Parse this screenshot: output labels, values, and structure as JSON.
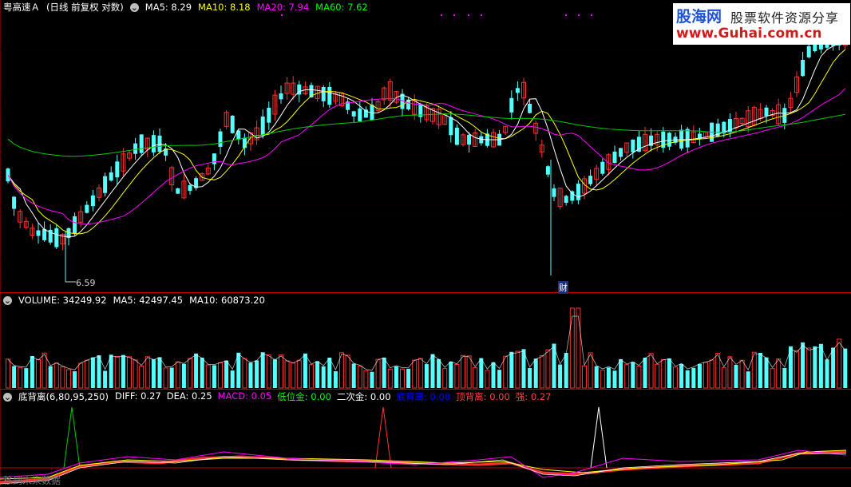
{
  "price_panel": {
    "stock_name": "粤高速Ａ",
    "mode": "(日线 前复权 对数)",
    "ma": [
      {
        "label": "MA5:",
        "value": "8.29",
        "color": "#ffffff"
      },
      {
        "label": "MA10:",
        "value": "8.18",
        "color": "#ffff00"
      },
      {
        "label": "MA20:",
        "value": "7.94",
        "color": "#ff00ff"
      },
      {
        "label": "MA60:",
        "value": "7.62",
        "color": "#00ff00"
      }
    ],
    "low_label": "6.59",
    "event_label": "财"
  },
  "volume_panel": {
    "items": [
      {
        "label": "VOLUME:",
        "value": "34249.92",
        "color": "#ffffff"
      },
      {
        "label": "MA5:",
        "value": "42497.45",
        "color": "#ffffff"
      },
      {
        "label": "MA10:",
        "value": "60873.20",
        "color": "#ffffff"
      }
    ]
  },
  "indicator_panel": {
    "name": "底背离(6,80,95,250)",
    "items": [
      {
        "label": "DIFF:",
        "value": "0.27",
        "color": "#ffffff"
      },
      {
        "label": "DEA:",
        "value": "0.25",
        "color": "#ffffff"
      },
      {
        "label": "MACD:",
        "value": "0.05",
        "color": "#ff00ff"
      },
      {
        "label": "低位金:",
        "value": "0.00",
        "color": "#00ff00"
      },
      {
        "label": "二次金:",
        "value": "0.00",
        "color": "#ffffff"
      },
      {
        "label": "底背离:",
        "value": "0.00",
        "color": "#0000ff"
      },
      {
        "label": "顶背离:",
        "value": "0.00",
        "color": "#ff4040"
      },
      {
        "label": "强:",
        "value": "0.27",
        "color": "#ff4040"
      }
    ]
  },
  "watermark": {
    "logo": "股海网",
    "slogan": "股票软件资源分享",
    "url": "www.Guhai.com.cn"
  },
  "footer_hint": "移到未来数据",
  "colors": {
    "up": "#ff3030",
    "down": "#54ffff",
    "grid": "#c00000"
  }
}
